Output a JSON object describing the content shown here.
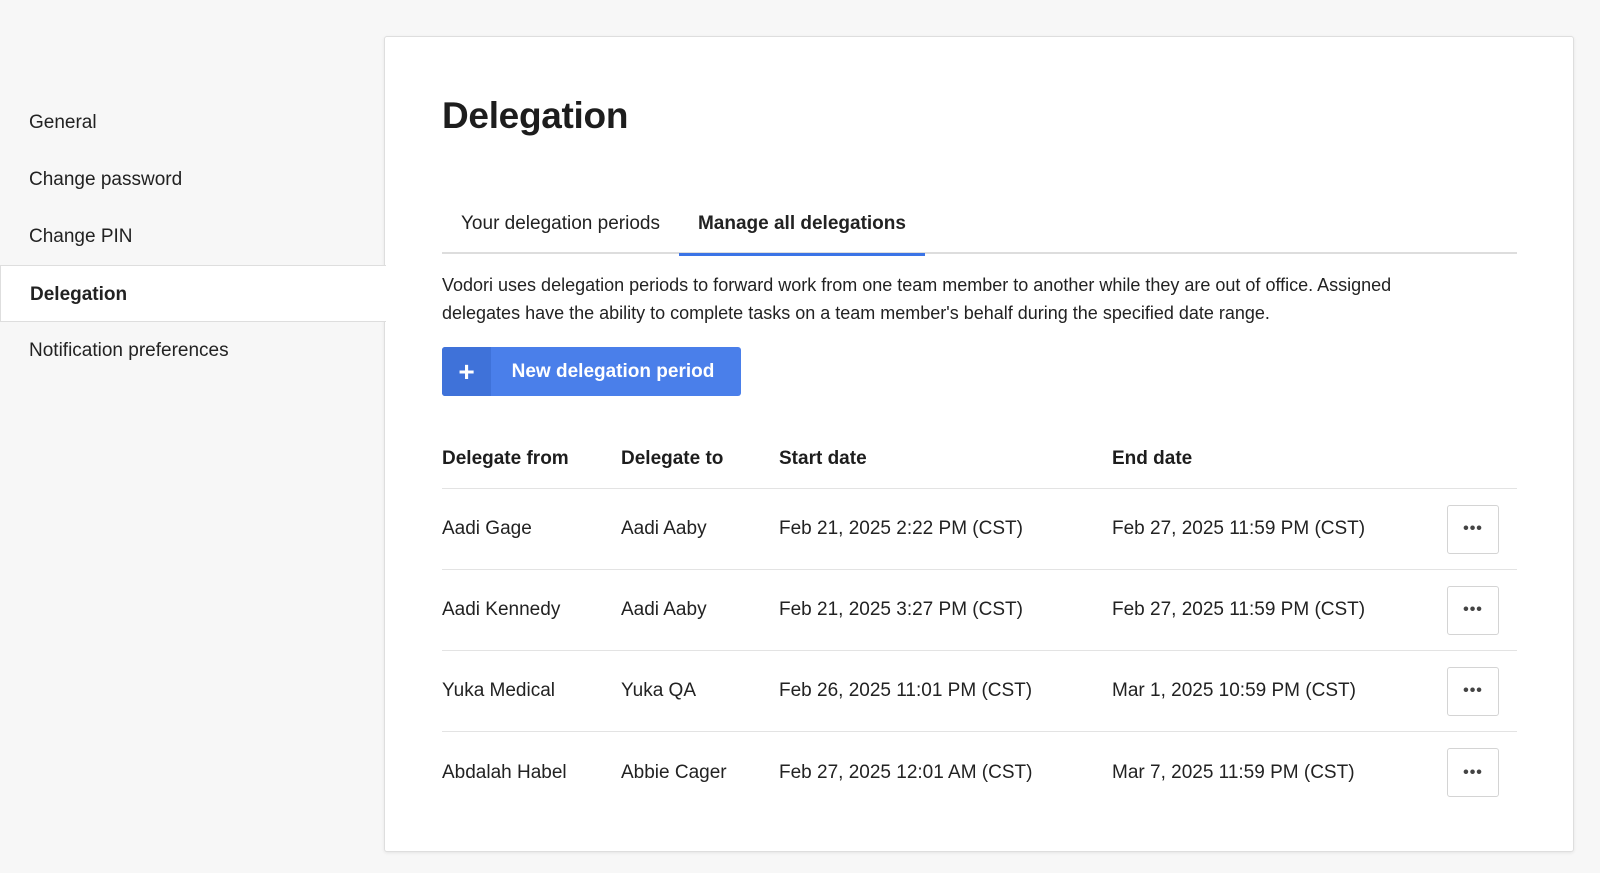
{
  "sidebar": {
    "items": [
      {
        "label": "General"
      },
      {
        "label": "Change password"
      },
      {
        "label": "Change PIN"
      },
      {
        "label": "Delegation",
        "active": true
      },
      {
        "label": "Notification preferences"
      }
    ]
  },
  "main": {
    "title": "Delegation",
    "tabs": [
      {
        "label": "Your delegation periods"
      },
      {
        "label": "Manage all delegations",
        "active": true
      }
    ],
    "description": "Vodori uses delegation periods to forward work from one team member to another while they are out of office. Assigned delegates have the ability to complete tasks on a team member's behalf during the specified date range.",
    "new_button": {
      "icon": "plus-icon",
      "label": "New delegation period"
    },
    "table": {
      "headers": [
        "Delegate from",
        "Delegate to",
        "Start date",
        "End date"
      ],
      "rows": [
        {
          "from": "Aadi Gage",
          "to": "Aadi Aaby",
          "start": "Feb 21, 2025 2:22 PM (CST)",
          "end": "Feb 27, 2025 11:59 PM (CST)"
        },
        {
          "from": "Aadi Kennedy",
          "to": "Aadi Aaby",
          "start": "Feb 21, 2025 3:27 PM (CST)",
          "end": "Feb 27, 2025 11:59 PM (CST)"
        },
        {
          "from": "Yuka Medical",
          "to": "Yuka QA",
          "start": "Feb 26, 2025 11:01 PM (CST)",
          "end": "Mar 1, 2025 10:59 PM (CST)"
        },
        {
          "from": "Abdalah Habel",
          "to": "Abbie Cager",
          "start": "Feb 27, 2025 12:01 AM (CST)",
          "end": "Mar 7, 2025 11:59 PM (CST)"
        }
      ],
      "row_action_icon": "more-horizontal-icon"
    }
  },
  "colors": {
    "accent": "#4a7fea",
    "background": "#f7f7f7",
    "panel": "#ffffff"
  }
}
